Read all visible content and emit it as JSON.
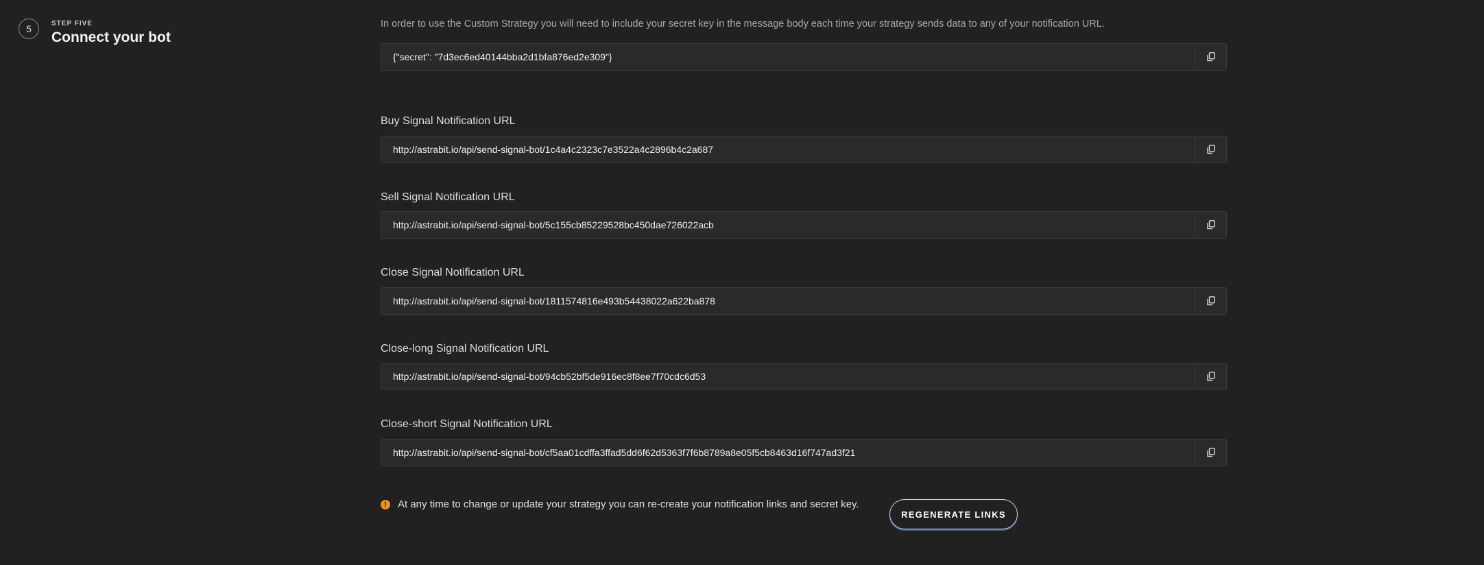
{
  "step": {
    "number": "5",
    "label": "STEP FIVE",
    "title": "Connect your bot"
  },
  "intro_text": "In order to use the Custom Strategy you will need to include your secret key in the message body each time your strategy sends data to any of your notification URL.",
  "secret": {
    "value": "{\"secret\": \"7d3ec6ed40144bba2d1bfa876ed2e309\"}"
  },
  "urls": [
    {
      "label": "Buy Signal Notification URL",
      "value": "http://astrabit.io/api/send-signal-bot/1c4a4c2323c7e3522a4c2896b4c2a687"
    },
    {
      "label": "Sell Signal Notification URL",
      "value": "http://astrabit.io/api/send-signal-bot/5c155cb85229528bc450dae726022acb"
    },
    {
      "label": "Close Signal Notification URL",
      "value": "http://astrabit.io/api/send-signal-bot/1811574816e493b54438022a622ba878"
    },
    {
      "label": "Close-long Signal Notification URL",
      "value": "http://astrabit.io/api/send-signal-bot/94cb52bf5de916ec8f8ee7f70cdc6d53"
    },
    {
      "label": "Close-short Signal Notification URL",
      "value": "http://astrabit.io/api/send-signal-bot/cf5aa01cdffa3ffad5dd6f62d5363f7f6b8789a8e05f5cb8463d16f747ad3f21"
    }
  ],
  "notice": {
    "icon": "warning-icon",
    "icon_glyph": "!",
    "text": "At any time to change or update your strategy you can re-create your notification links and secret key."
  },
  "regenerate_label": "REGENERATE LINKS",
  "colors": {
    "background": "#212121",
    "field_background": "#2a2a2a",
    "warning": "#f0902a",
    "button_shadow": "#3a5f9a"
  }
}
